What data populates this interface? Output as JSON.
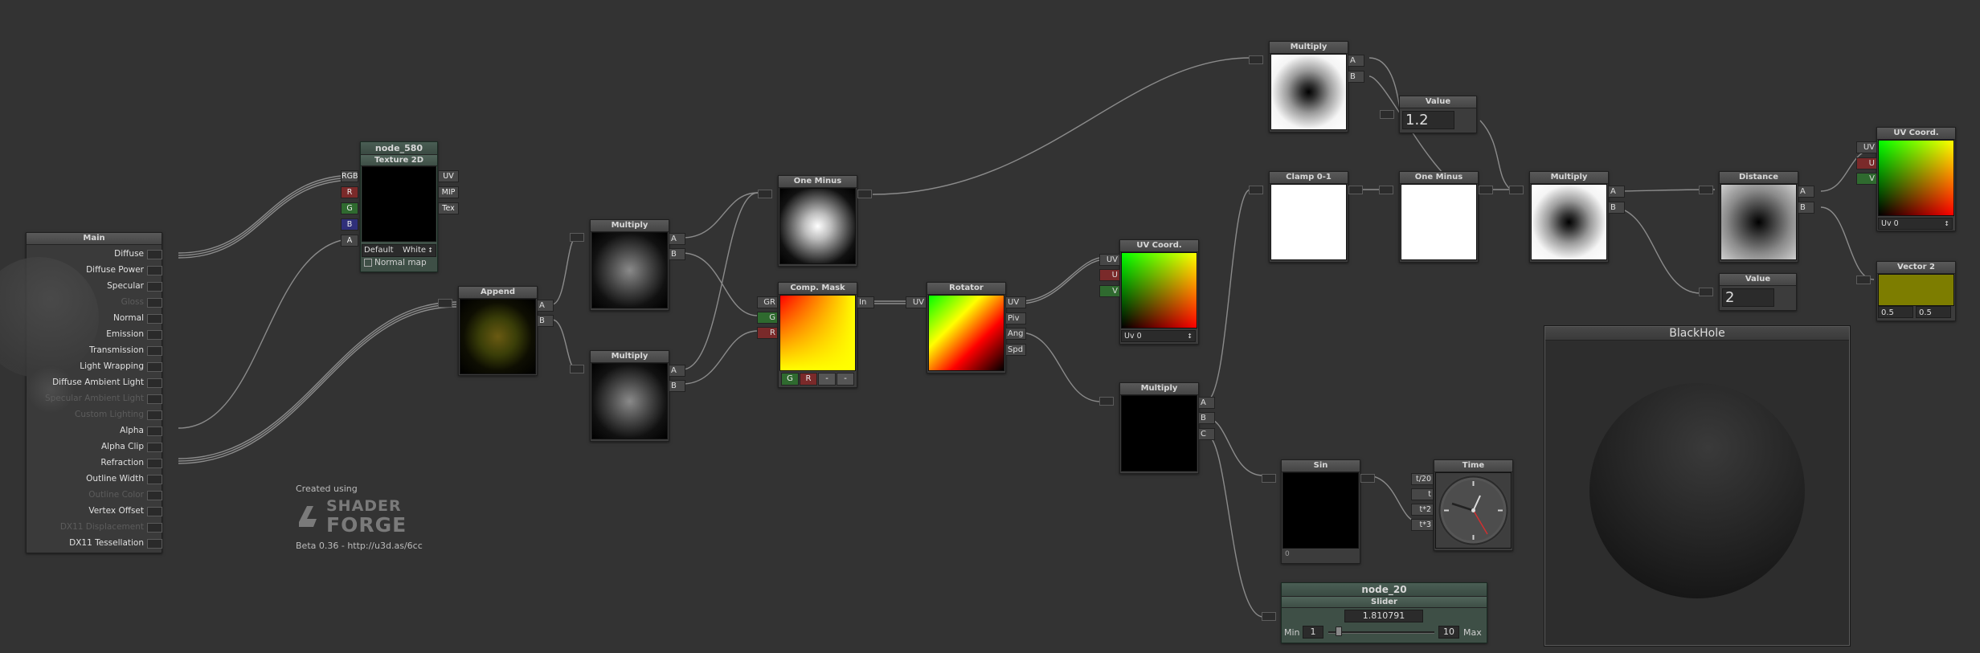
{
  "main_node": {
    "title": "Main",
    "inputs": [
      {
        "label": "Diffuse",
        "enabled": true
      },
      {
        "label": "Diffuse Power",
        "enabled": true
      },
      {
        "label": "Specular",
        "enabled": true
      },
      {
        "label": "Gloss",
        "enabled": false
      },
      {
        "label": "Normal",
        "enabled": true
      },
      {
        "label": "Emission",
        "enabled": true
      },
      {
        "label": "Transmission",
        "enabled": true
      },
      {
        "label": "Light Wrapping",
        "enabled": true
      },
      {
        "label": "Diffuse Ambient Light",
        "enabled": true
      },
      {
        "label": "Specular Ambient Light",
        "enabled": false
      },
      {
        "label": "Custom Lighting",
        "enabled": false
      },
      {
        "label": "Alpha",
        "enabled": true
      },
      {
        "label": "Alpha Clip",
        "enabled": true
      },
      {
        "label": "Refraction",
        "enabled": true
      },
      {
        "label": "Outline Width",
        "enabled": true
      },
      {
        "label": "Outline Color",
        "enabled": false
      },
      {
        "label": "Vertex Offset",
        "enabled": true
      },
      {
        "label": "DX11 Displacement",
        "enabled": false
      },
      {
        "label": "DX11 Tessellation",
        "enabled": true
      }
    ]
  },
  "texture_node": {
    "name": "node_580",
    "title": "Texture 2D",
    "left_ports": [
      "RGB",
      "R",
      "G",
      "B",
      "A"
    ],
    "right_ports": [
      "UV",
      "MIP",
      "Tex"
    ],
    "default_label": "Default",
    "default_value": "White",
    "normal_map_label": "Normal map"
  },
  "append_node": {
    "title": "Append",
    "outputs": [
      "A",
      "B"
    ]
  },
  "multiply_top": {
    "title": "Multiply",
    "outputs": [
      "A",
      "B"
    ]
  },
  "multiply_bottom": {
    "title": "Multiply",
    "outputs": [
      "A",
      "B"
    ]
  },
  "one_minus_left": {
    "title": "One Minus"
  },
  "comp_mask": {
    "title": "Comp. Mask",
    "left_ports": [
      "GR",
      "G",
      "R"
    ],
    "right_port": "In",
    "buttons": [
      "G",
      "R",
      "-",
      "-"
    ]
  },
  "rotator": {
    "title": "Rotator",
    "left_port": "UV",
    "right_ports": [
      "UV",
      "Piv",
      "Ang",
      "Spd"
    ]
  },
  "uv_coord_mid": {
    "title": "UV Coord.",
    "ports": [
      "UV",
      "U",
      "V"
    ],
    "select": "Uv 0"
  },
  "multiply_mid": {
    "title": "Multiply",
    "ports": [
      "A",
      "B",
      "C"
    ]
  },
  "multiply_top_right": {
    "title": "Multiply",
    "ports": [
      "A",
      "B"
    ]
  },
  "value_top": {
    "title": "Value",
    "value": "1.2"
  },
  "clamp": {
    "title": "Clamp 0-1"
  },
  "one_minus_right": {
    "title": "One Minus"
  },
  "multiply_right": {
    "title": "Multiply",
    "ports": [
      "A",
      "B"
    ]
  },
  "distance": {
    "title": "Distance",
    "ports": [
      "A",
      "B"
    ]
  },
  "value_bottom": {
    "title": "Value",
    "value": "2"
  },
  "uv_coord_right": {
    "title": "UV Coord.",
    "ports": [
      "UV",
      "U",
      "V"
    ],
    "select": "Uv 0"
  },
  "vector2": {
    "title": "Vector 2",
    "x": "0.5",
    "y": "0.5"
  },
  "sin_node": {
    "title": "Sin",
    "value": "0"
  },
  "time_node": {
    "title": "Time",
    "ports": [
      "t/20",
      "t",
      "t*2",
      "t*3"
    ]
  },
  "slider_node": {
    "name": "node_20",
    "title": "Slider",
    "value": "1.810791",
    "min_label": "Min",
    "min": "1",
    "max": "10",
    "max_label": "Max",
    "fraction": 0.09
  },
  "preview_window": {
    "title": "BlackHole"
  },
  "branding": {
    "created_using": "Created using",
    "logo_top": "SHADER",
    "logo_bottom": "FORGE",
    "version": "Beta 0.36 - http://u3d.as/6cc"
  },
  "colors": {
    "background": "#333333",
    "node": "#3c3c3c",
    "wire": "#8a8a8a",
    "red": "#7a2a2a",
    "green": "#2f6a2f",
    "blue": "#2f2f7a"
  }
}
